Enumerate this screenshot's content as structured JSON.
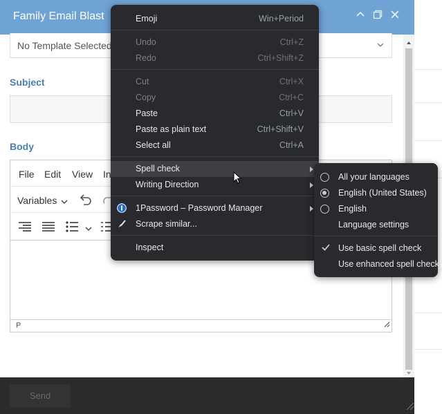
{
  "dialog": {
    "title": "Family Email Blast",
    "template_select": "No Template Selected",
    "subject_label": "Subject",
    "subject_value": "",
    "body_label": "Body",
    "send_label": "Send"
  },
  "editor": {
    "menu": [
      "File",
      "Edit",
      "View",
      "In"
    ],
    "variables_label": "Variables",
    "status_path": "P"
  },
  "context_menu": {
    "items": [
      {
        "label": "Emoji",
        "shortcut": "Win+Period"
      },
      {
        "label": "Undo",
        "shortcut": "Ctrl+Z"
      },
      {
        "label": "Redo",
        "shortcut": "Ctrl+Shift+Z"
      },
      {
        "label": "Cut",
        "shortcut": "Ctrl+X"
      },
      {
        "label": "Copy",
        "shortcut": "Ctrl+C"
      },
      {
        "label": "Paste",
        "shortcut": "Ctrl+V"
      },
      {
        "label": "Paste as plain text",
        "shortcut": "Ctrl+Shift+V"
      },
      {
        "label": "Select all",
        "shortcut": "Ctrl+A"
      },
      {
        "label": "Spell check",
        "shortcut": ""
      },
      {
        "label": "Writing Direction",
        "shortcut": ""
      },
      {
        "label": "1Password – Password Manager",
        "shortcut": ""
      },
      {
        "label": "Scrape similar...",
        "shortcut": ""
      },
      {
        "label": "Inspect",
        "shortcut": ""
      }
    ]
  },
  "spellcheck_menu": {
    "items": [
      {
        "label": "All your languages"
      },
      {
        "label": "English (United States)"
      },
      {
        "label": "English"
      },
      {
        "label": "Language settings"
      },
      {
        "label": "Use basic spell check"
      },
      {
        "label": "Use enhanced spell check"
      }
    ]
  },
  "colors": {
    "titlebar": "#6fa3d5",
    "label_accent": "#4a7fba",
    "menu_bg": "#292a2d",
    "footer_bg": "#2b2b2b"
  },
  "icons": [
    "minimize-icon",
    "maximize-icon",
    "close-icon",
    "chevron-down-icon",
    "undo-icon",
    "redo-icon",
    "align-right-icon",
    "justify-icon",
    "bullet-list-icon",
    "numbered-list-icon",
    "onepassword-icon",
    "scrape-brush-icon",
    "check-icon",
    "resize-grip-icon",
    "mouse-cursor-icon"
  ]
}
